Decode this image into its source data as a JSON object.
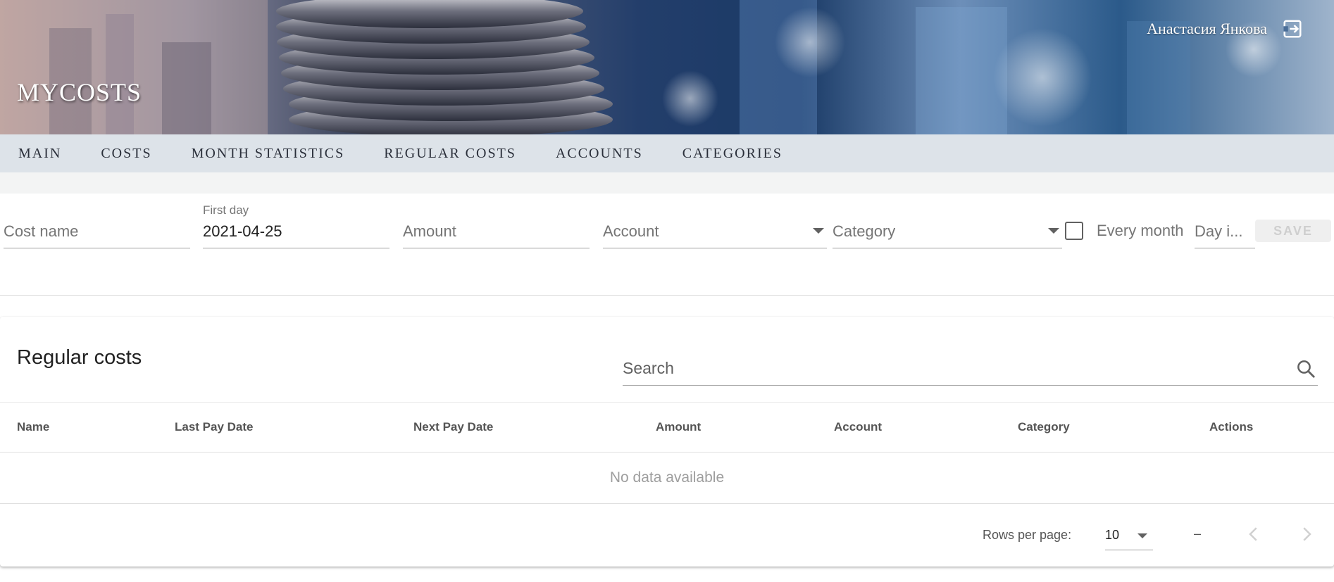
{
  "header": {
    "brand": "MYCOSTS",
    "user_name": "Анастасия Янкова",
    "logout_icon": "logout-icon"
  },
  "nav": {
    "items": [
      {
        "label": "MAIN"
      },
      {
        "label": "COSTS"
      },
      {
        "label": "MONTH STATISTICS"
      },
      {
        "label": "REGULAR COSTS"
      },
      {
        "label": "ACCOUNTS"
      },
      {
        "label": "CATEGORIES"
      }
    ]
  },
  "form": {
    "cost_name_placeholder": "Cost name",
    "first_day_label": "First day",
    "first_day_value": "2021-04-25",
    "amount_placeholder": "Amount",
    "account_placeholder": "Account",
    "category_placeholder": "Category",
    "every_month_label": "Every month",
    "every_month_checked": false,
    "day_placeholder": "Day i...",
    "save_label": "SAVE"
  },
  "table": {
    "title": "Regular costs",
    "search_placeholder": "Search",
    "columns": [
      "Name",
      "Last Pay Date",
      "Next Pay Date",
      "Amount",
      "Account",
      "Category",
      "Actions"
    ],
    "empty_text": "No data available",
    "rows_per_page_label": "Rows per page:",
    "rows_per_page_value": "10",
    "range_text": "–"
  },
  "colors": {
    "nav_bg": "#dde3e9",
    "text_primary": "#212121",
    "text_muted": "#757575"
  }
}
